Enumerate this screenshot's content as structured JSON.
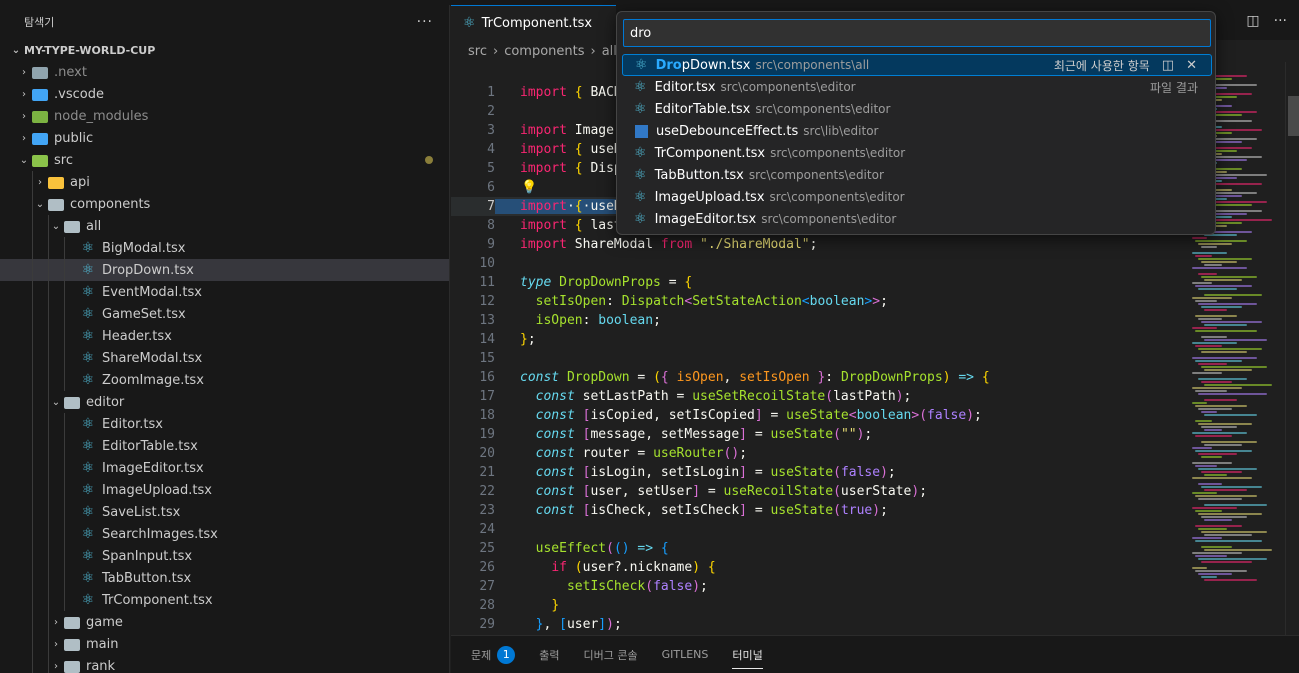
{
  "sidebar": {
    "title": "탐색기",
    "more": "···",
    "project": "MY-TYPE-WORLD-CUP",
    "tree": [
      {
        "label": ".next",
        "kind": "folder",
        "color": "grey",
        "depth": 1,
        "open": false,
        "dim": true
      },
      {
        "label": ".vscode",
        "kind": "folder",
        "color": "blue",
        "depth": 1,
        "open": false
      },
      {
        "label": "node_modules",
        "kind": "folder",
        "color": "green",
        "depth": 1,
        "open": false,
        "dim": true
      },
      {
        "label": "public",
        "kind": "folder",
        "color": "blue",
        "depth": 1,
        "open": false
      },
      {
        "label": "src",
        "kind": "folder",
        "color": "lime",
        "depth": 1,
        "open": true,
        "modified": true
      },
      {
        "label": "api",
        "kind": "folder",
        "color": "yellow",
        "depth": 2,
        "open": false
      },
      {
        "label": "components",
        "kind": "folder",
        "color": "pal",
        "depth": 2,
        "open": true
      },
      {
        "label": "all",
        "kind": "folder",
        "color": "pal",
        "depth": 3,
        "open": true
      },
      {
        "label": "BigModal.tsx",
        "kind": "react",
        "depth": 4
      },
      {
        "label": "DropDown.tsx",
        "kind": "react",
        "depth": 4,
        "selected": true
      },
      {
        "label": "EventModal.tsx",
        "kind": "react",
        "depth": 4
      },
      {
        "label": "GameSet.tsx",
        "kind": "react",
        "depth": 4
      },
      {
        "label": "Header.tsx",
        "kind": "react",
        "depth": 4
      },
      {
        "label": "ShareModal.tsx",
        "kind": "react",
        "depth": 4
      },
      {
        "label": "ZoomImage.tsx",
        "kind": "react",
        "depth": 4
      },
      {
        "label": "editor",
        "kind": "folder",
        "color": "pal",
        "depth": 3,
        "open": true
      },
      {
        "label": "Editor.tsx",
        "kind": "react",
        "depth": 4
      },
      {
        "label": "EditorTable.tsx",
        "kind": "react",
        "depth": 4
      },
      {
        "label": "ImageEditor.tsx",
        "kind": "react",
        "depth": 4
      },
      {
        "label": "ImageUpload.tsx",
        "kind": "react",
        "depth": 4
      },
      {
        "label": "SaveList.tsx",
        "kind": "react",
        "depth": 4
      },
      {
        "label": "SearchImages.tsx",
        "kind": "react",
        "depth": 4
      },
      {
        "label": "SpanInput.tsx",
        "kind": "react",
        "depth": 4
      },
      {
        "label": "TabButton.tsx",
        "kind": "react",
        "depth": 4
      },
      {
        "label": "TrComponent.tsx",
        "kind": "react",
        "depth": 4
      },
      {
        "label": "game",
        "kind": "folder",
        "color": "pal",
        "depth": 3,
        "open": false
      },
      {
        "label": "main",
        "kind": "folder",
        "color": "pal",
        "depth": 3,
        "open": false
      },
      {
        "label": "rank",
        "kind": "folder",
        "color": "pal",
        "depth": 3,
        "open": false
      }
    ]
  },
  "editor": {
    "tab_label": "TrComponent.tsx",
    "breadcrumb": [
      "src",
      "components",
      "all"
    ],
    "current_line": 7
  },
  "quick_open": {
    "query": "dro",
    "recent_label": "최근에 사용한 항목",
    "files_label": "파일 결과",
    "items": [
      {
        "name": "DropDown.tsx",
        "match": "Dro",
        "path": "src\\components\\all",
        "kind": "react",
        "active": true
      },
      {
        "name": "Editor.tsx",
        "match": "",
        "path": "src\\components\\editor",
        "kind": "react"
      },
      {
        "name": "EditorTable.tsx",
        "match": "",
        "path": "src\\components\\editor",
        "kind": "react"
      },
      {
        "name": "useDebounceEffect.ts",
        "match": "",
        "path": "src\\lib\\editor",
        "kind": "ts"
      },
      {
        "name": "TrComponent.tsx",
        "match": "",
        "path": "src\\components\\editor",
        "kind": "react"
      },
      {
        "name": "TabButton.tsx",
        "match": "",
        "path": "src\\components\\editor",
        "kind": "react"
      },
      {
        "name": "ImageUpload.tsx",
        "match": "",
        "path": "src\\components\\editor",
        "kind": "react"
      },
      {
        "name": "ImageEditor.tsx",
        "match": "",
        "path": "src\\components\\editor",
        "kind": "react"
      }
    ]
  },
  "panel": {
    "tabs": [
      {
        "label": "문제",
        "badge": "1"
      },
      {
        "label": "출력"
      },
      {
        "label": "디버그 콘솔"
      },
      {
        "label": "GITLENS"
      },
      {
        "label": "터미널",
        "active": true
      }
    ]
  },
  "code_lines": [
    [
      [
        "k",
        "import"
      ],
      [
        "w",
        " "
      ],
      [
        "br1",
        "{"
      ],
      [
        "w",
        " BACK"
      ]
    ],
    [],
    [
      [
        "k",
        "import"
      ],
      [
        "w",
        " Image"
      ]
    ],
    [
      [
        "k",
        "import"
      ],
      [
        "w",
        " "
      ],
      [
        "br1",
        "{"
      ],
      [
        "w",
        " useR"
      ]
    ],
    [
      [
        "k",
        "import"
      ],
      [
        "w",
        " "
      ],
      [
        "br1",
        "{"
      ],
      [
        "w",
        " Disp"
      ]
    ],
    [],
    [
      [
        "k",
        "import"
      ],
      [
        "w",
        "·"
      ],
      [
        "br1",
        "{"
      ],
      [
        "w",
        "·useR"
      ]
    ],
    [
      [
        "k",
        "import"
      ],
      [
        "w",
        " "
      ],
      [
        "br1",
        "{"
      ],
      [
        "w",
        " last"
      ]
    ],
    [
      [
        "k",
        "import"
      ],
      [
        "w",
        " ShareModal "
      ],
      [
        "k",
        "from"
      ],
      [
        "w",
        " "
      ],
      [
        "s",
        "\"./ShareModal\""
      ],
      [
        "w",
        ";"
      ]
    ],
    [],
    [
      [
        "kw",
        "type"
      ],
      [
        "w",
        " "
      ],
      [
        "f",
        "DropDownProps"
      ],
      [
        "w",
        " = "
      ],
      [
        "br1",
        "{"
      ]
    ],
    [
      [
        "w",
        "  "
      ],
      [
        "f",
        "setIsOpen"
      ],
      [
        "w",
        ": "
      ],
      [
        "f",
        "Dispatch"
      ],
      [
        "br2",
        "<"
      ],
      [
        "f",
        "SetStateAction"
      ],
      [
        "br3",
        "<"
      ],
      [
        "t",
        "boolean"
      ],
      [
        "br3",
        ">"
      ],
      [
        "br2",
        ">"
      ],
      [
        "w",
        ";"
      ]
    ],
    [
      [
        "w",
        "  "
      ],
      [
        "f",
        "isOpen"
      ],
      [
        "w",
        ": "
      ],
      [
        "t",
        "boolean"
      ],
      [
        "w",
        ";"
      ]
    ],
    [
      [
        "br1",
        "}"
      ],
      [
        "w",
        ";"
      ]
    ],
    [],
    [
      [
        "kw",
        "const"
      ],
      [
        "w",
        " "
      ],
      [
        "f",
        "DropDown"
      ],
      [
        "w",
        " = "
      ],
      [
        "br1",
        "("
      ],
      [
        "br2",
        "{"
      ],
      [
        "w",
        " "
      ],
      [
        "p",
        "isOpen"
      ],
      [
        "w",
        ", "
      ],
      [
        "p",
        "setIsOpen"
      ],
      [
        "w",
        " "
      ],
      [
        "br2",
        "}"
      ],
      [
        "w",
        ": "
      ],
      [
        "f",
        "DropDownProps"
      ],
      [
        "br1",
        ")"
      ],
      [
        "w",
        " "
      ],
      [
        "kw",
        "=>"
      ],
      [
        "w",
        " "
      ],
      [
        "br1",
        "{"
      ]
    ],
    [
      [
        "w",
        "  "
      ],
      [
        "kw",
        "const"
      ],
      [
        "w",
        " setLastPath = "
      ],
      [
        "f",
        "useSetRecoilState"
      ],
      [
        "br2",
        "("
      ],
      [
        "w",
        "lastPath"
      ],
      [
        "br2",
        ")"
      ],
      [
        "w",
        ";"
      ]
    ],
    [
      [
        "w",
        "  "
      ],
      [
        "kw",
        "const"
      ],
      [
        "w",
        " "
      ],
      [
        "br2",
        "["
      ],
      [
        "w",
        "isCopied, setIsCopied"
      ],
      [
        "br2",
        "]"
      ],
      [
        "w",
        " = "
      ],
      [
        "f",
        "useState"
      ],
      [
        "br2",
        "<"
      ],
      [
        "t",
        "boolean"
      ],
      [
        "br2",
        ">"
      ],
      [
        "br2",
        "("
      ],
      [
        "n",
        "false"
      ],
      [
        "br2",
        ")"
      ],
      [
        "w",
        ";"
      ]
    ],
    [
      [
        "w",
        "  "
      ],
      [
        "kw",
        "const"
      ],
      [
        "w",
        " "
      ],
      [
        "br2",
        "["
      ],
      [
        "w",
        "message, setMessage"
      ],
      [
        "br2",
        "]"
      ],
      [
        "w",
        " = "
      ],
      [
        "f",
        "useState"
      ],
      [
        "br2",
        "("
      ],
      [
        "s",
        "\"\""
      ],
      [
        "br2",
        ")"
      ],
      [
        "w",
        ";"
      ]
    ],
    [
      [
        "w",
        "  "
      ],
      [
        "kw",
        "const"
      ],
      [
        "w",
        " router = "
      ],
      [
        "f",
        "useRouter"
      ],
      [
        "br2",
        "()"
      ],
      [
        "w",
        ";"
      ]
    ],
    [
      [
        "w",
        "  "
      ],
      [
        "kw",
        "const"
      ],
      [
        "w",
        " "
      ],
      [
        "br2",
        "["
      ],
      [
        "w",
        "isLogin, setIsLogin"
      ],
      [
        "br2",
        "]"
      ],
      [
        "w",
        " = "
      ],
      [
        "f",
        "useState"
      ],
      [
        "br2",
        "("
      ],
      [
        "n",
        "false"
      ],
      [
        "br2",
        ")"
      ],
      [
        "w",
        ";"
      ]
    ],
    [
      [
        "w",
        "  "
      ],
      [
        "kw",
        "const"
      ],
      [
        "w",
        " "
      ],
      [
        "br2",
        "["
      ],
      [
        "w",
        "user, setUser"
      ],
      [
        "br2",
        "]"
      ],
      [
        "w",
        " = "
      ],
      [
        "f",
        "useRecoilState"
      ],
      [
        "br2",
        "("
      ],
      [
        "w",
        "userState"
      ],
      [
        "br2",
        ")"
      ],
      [
        "w",
        ";"
      ]
    ],
    [
      [
        "w",
        "  "
      ],
      [
        "kw",
        "const"
      ],
      [
        "w",
        " "
      ],
      [
        "br2",
        "["
      ],
      [
        "w",
        "isCheck, setIsCheck"
      ],
      [
        "br2",
        "]"
      ],
      [
        "w",
        " = "
      ],
      [
        "f",
        "useState"
      ],
      [
        "br2",
        "("
      ],
      [
        "n",
        "true"
      ],
      [
        "br2",
        ")"
      ],
      [
        "w",
        ";"
      ]
    ],
    [],
    [
      [
        "w",
        "  "
      ],
      [
        "f",
        "useEffect"
      ],
      [
        "br2",
        "("
      ],
      [
        "br3",
        "()"
      ],
      [
        "w",
        " "
      ],
      [
        "kw",
        "=>"
      ],
      [
        "w",
        " "
      ],
      [
        "br3",
        "{"
      ]
    ],
    [
      [
        "w",
        "    "
      ],
      [
        "k",
        "if"
      ],
      [
        "w",
        " "
      ],
      [
        "br1",
        "("
      ],
      [
        "w",
        "user?.nickname"
      ],
      [
        "br1",
        ")"
      ],
      [
        "w",
        " "
      ],
      [
        "br1",
        "{"
      ]
    ],
    [
      [
        "w",
        "      "
      ],
      [
        "f",
        "setIsCheck"
      ],
      [
        "br2",
        "("
      ],
      [
        "n",
        "false"
      ],
      [
        "br2",
        ")"
      ],
      [
        "w",
        ";"
      ]
    ],
    [
      [
        "w",
        "    "
      ],
      [
        "br1",
        "}"
      ]
    ],
    [
      [
        "w",
        "  "
      ],
      [
        "br3",
        "}"
      ],
      [
        "w",
        ", "
      ],
      [
        "br3",
        "["
      ],
      [
        "w",
        "user"
      ],
      [
        "br3",
        "]"
      ],
      [
        "br2",
        ")"
      ],
      [
        "w",
        ";"
      ]
    ]
  ]
}
